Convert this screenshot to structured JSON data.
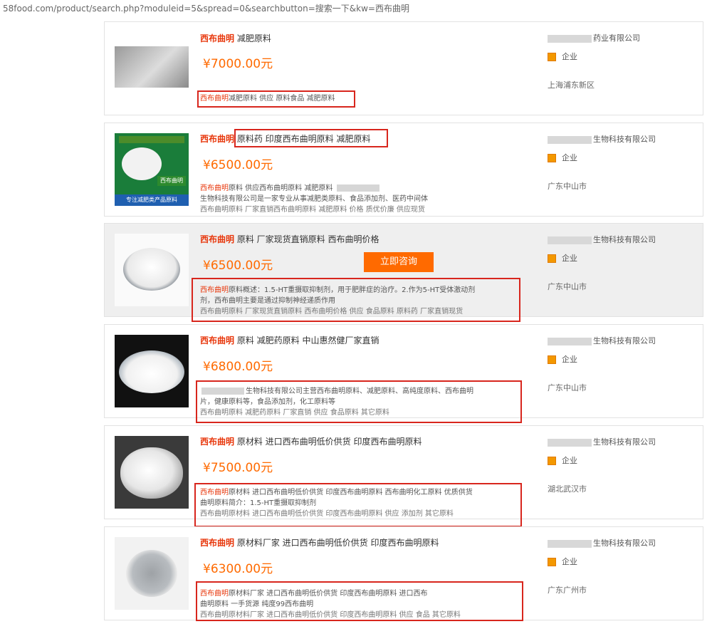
{
  "url": "58food.com/product/search.php?moduleid=5&spread=0&searchbutton=搜索一下&kw=西布曲明",
  "consult_button": "立即咨询",
  "items": [
    {
      "title_kw": "西布曲明",
      "title_rest": "减肥原料",
      "price": "¥7000.00元",
      "desc_line1_kw": "西布曲明",
      "desc_line1_rest": "减肥原料 供应 原料食品 减肥原料",
      "desc_line2": "",
      "desc_line3": "",
      "company": "药业有限公司",
      "badge": "企业",
      "location": "上海浦东新区"
    },
    {
      "title_kw": "西布曲明",
      "title_rest": "原料药 印度西布曲明原料 减肥原料",
      "price": "¥6500.00元",
      "desc_line1_kw": "西布曲明",
      "desc_line1_rest": "原料 供应西布曲明原料 减肥原料",
      "desc_line2": "生物科技有限公司是一家专业从事减肥类原料、食品添加剂、医药中间体",
      "desc_line3": "西布曲明原料 厂家直销西布曲明原料 减肥原料 价格 质优价廉 供应现货",
      "company": "生物科技有限公司",
      "badge": "企业",
      "location": "广东中山市",
      "package_label": "西布曲明",
      "package_foot": "专注减肥类产品原料"
    },
    {
      "title_kw": "西布曲明",
      "title_rest": "原料 厂家现货直销原料 西布曲明价格",
      "price": "¥6500.00元",
      "desc_line1_kw": "西布曲明",
      "desc_line1_rest": "原料概述：1.5-HT重摄取抑制剂，用于肥胖症的治疗。2.作为5-HT受体激动剂",
      "desc_line2": "剂，西布曲明主要是通过抑制神经递质作用",
      "desc_line3": "西布曲明原料 厂家现货直销原料 西布曲明价格 供应 食品原料 原料药 厂家直销现货",
      "company": "生物科技有限公司",
      "badge": "企业",
      "location": "广东中山市"
    },
    {
      "title_kw": "西布曲明",
      "title_rest": "原料 减肥药原料 中山惠然健厂家直销",
      "price": "¥6800.00元",
      "desc_line1_kw": "",
      "desc_line1_rest": "生物科技有限公司主营西布曲明原料、减肥原料、高纯度原料、西布曲明",
      "desc_line2": "片，健康原料等，食品添加剂，化工原料等",
      "desc_line3": "西布曲明原料 减肥药原料 厂家直销 供应 食品原料 其它原料",
      "company": "生物科技有限公司",
      "badge": "企业",
      "location": "广东中山市"
    },
    {
      "title_kw": "西布曲明",
      "title_rest": "原材料 进口西布曲明低价供货 印度西布曲明原料",
      "price": "¥7500.00元",
      "desc_line1_kw": "西布曲明",
      "desc_line1_rest": "原材料 进口西布曲明低价供货 印度西布曲明原料 西布曲明化工原料 优质供货",
      "desc_line2": "曲明原料简介：1.5-HT重摄取抑制剂",
      "desc_line3": "西布曲明原材料 进口西布曲明低价供货 印度西布曲明原料 供应 添加剂 其它原料",
      "company": "生物科技有限公司",
      "badge": "企业",
      "location": "湖北武汉市"
    },
    {
      "title_kw": "西布曲明",
      "title_rest": "原材料厂家 进口西布曲明低价供货 印度西布曲明原料",
      "price": "¥6300.00元",
      "desc_line1_kw": "西布曲明",
      "desc_line1_rest": "原材料厂家 进口西布曲明低价供货 印度西布曲明原料 进口西布",
      "desc_line2": "曲明原料 一手货源 纯度99西布曲明",
      "desc_line3": "西布曲明原材料厂家 进口西布曲明低价供货 印度西布曲明原料 供应 食品 其它原料",
      "company": "生物科技有限公司",
      "badge": "企业",
      "location": "广东广州市"
    }
  ]
}
